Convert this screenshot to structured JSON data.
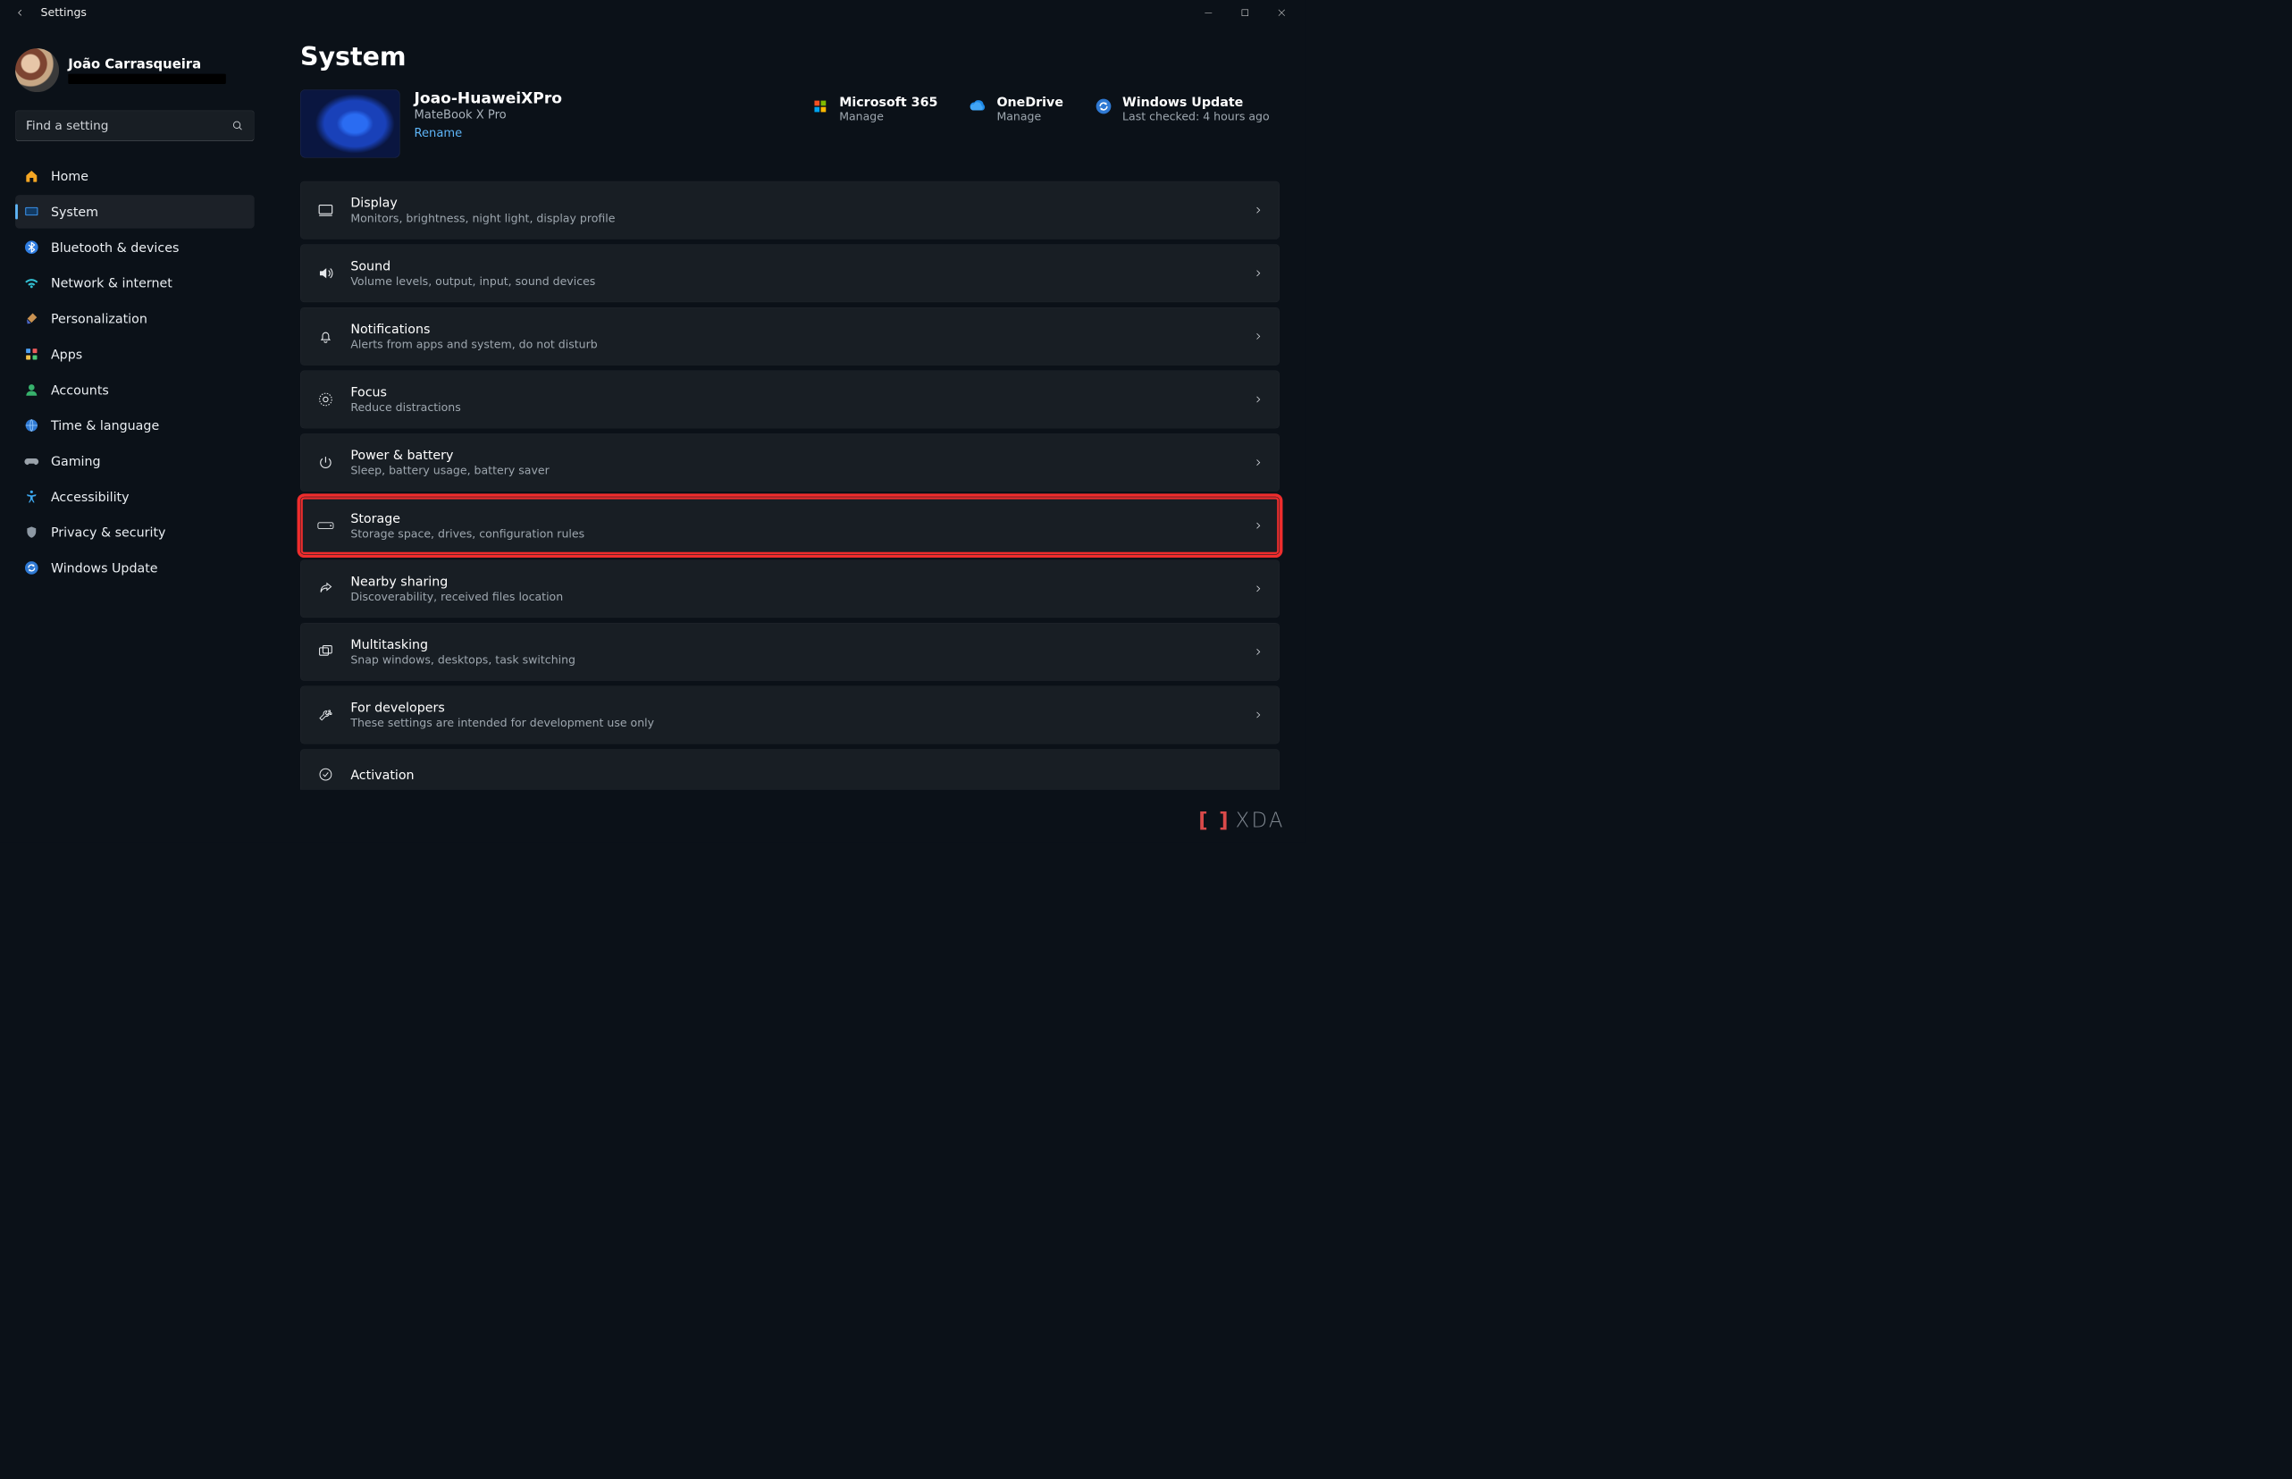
{
  "window": {
    "title": "Settings"
  },
  "user": {
    "name": "João Carrasqueira"
  },
  "search": {
    "placeholder": "Find a setting"
  },
  "sidebar": {
    "items": [
      {
        "label": "Home"
      },
      {
        "label": "System"
      },
      {
        "label": "Bluetooth & devices"
      },
      {
        "label": "Network & internet"
      },
      {
        "label": "Personalization"
      },
      {
        "label": "Apps"
      },
      {
        "label": "Accounts"
      },
      {
        "label": "Time & language"
      },
      {
        "label": "Gaming"
      },
      {
        "label": "Accessibility"
      },
      {
        "label": "Privacy & security"
      },
      {
        "label": "Windows Update"
      }
    ]
  },
  "page": {
    "title": "System"
  },
  "device": {
    "name": "Joao-HuaweiXPro",
    "model": "MateBook X Pro",
    "rename": "Rename"
  },
  "quick": {
    "m365": {
      "title": "Microsoft 365",
      "sub": "Manage"
    },
    "onedrive": {
      "title": "OneDrive",
      "sub": "Manage"
    },
    "update": {
      "title": "Windows Update",
      "sub": "Last checked: 4 hours ago"
    }
  },
  "rows": [
    {
      "title": "Display",
      "desc": "Monitors, brightness, night light, display profile"
    },
    {
      "title": "Sound",
      "desc": "Volume levels, output, input, sound devices"
    },
    {
      "title": "Notifications",
      "desc": "Alerts from apps and system, do not disturb"
    },
    {
      "title": "Focus",
      "desc": "Reduce distractions"
    },
    {
      "title": "Power & battery",
      "desc": "Sleep, battery usage, battery saver"
    },
    {
      "title": "Storage",
      "desc": "Storage space, drives, configuration rules"
    },
    {
      "title": "Nearby sharing",
      "desc": "Discoverability, received files location"
    },
    {
      "title": "Multitasking",
      "desc": "Snap windows, desktops, task switching"
    },
    {
      "title": "For developers",
      "desc": "These settings are intended for development use only"
    },
    {
      "title": "Activation",
      "desc": ""
    }
  ],
  "watermark": "XDA"
}
